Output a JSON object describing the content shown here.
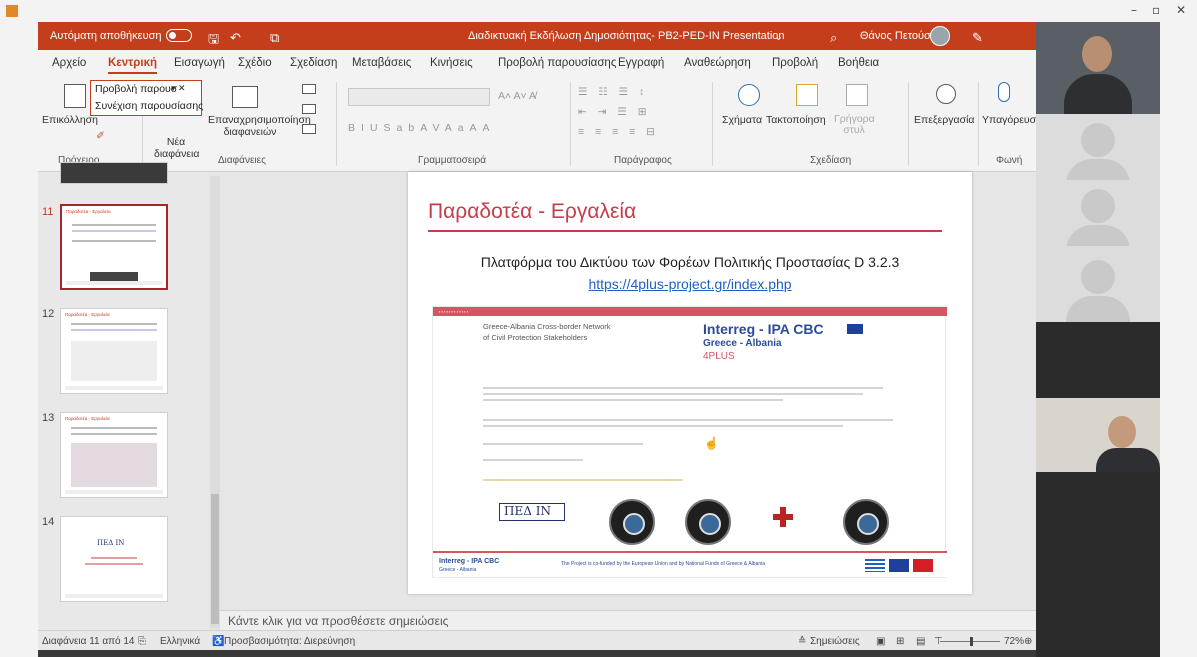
{
  "window": {
    "controls": [
      "–",
      "▫",
      "✕"
    ]
  },
  "titlebar": {
    "autosave": "Αυτόματη αποθήκευση",
    "document": "Διαδικτυακή Εκδήλωση Δημοσιότητας- PB2-PED-IN Presentation",
    "document_caret": "⌄",
    "user": "Θάνος Πετούσης"
  },
  "tabs": [
    "Αρχείο",
    "Κεντρική",
    "Εισαγωγή",
    "Σχέδιο",
    "Σχεδίαση",
    "Μεταβάσεις",
    "Κινήσεις",
    "Προβολή παρουσίασης",
    "Εγγραφή",
    "Αναθεώρηση",
    "Προβολή",
    "Βοήθεια"
  ],
  "active_tab": "Κεντρική",
  "ribbon": {
    "paste": "Επικόλληση",
    "new_slide": "Νέα διαφάνεια",
    "reuse": "Επαναχρησιμοποίηση διαφανειών",
    "shapes": "Σχήματα",
    "arrange": "Τακτοποίηση",
    "quick_styles": "Γρήγορα στυλ",
    "editing": "Επεξεργασία",
    "dictate": "Υπαγόρευση",
    "groups": [
      "Πρόχειρο",
      "Διαφάνειες",
      "Γραμματοσειρά",
      "Παράγραφος",
      "Σχεδίαση",
      "Φωνή"
    ],
    "formatting": [
      "B",
      "I",
      "U",
      "S",
      "ab",
      "AV",
      "Aa",
      "A",
      "A"
    ]
  },
  "dropdown": {
    "items": [
      "Προβολή παρουσ",
      "Συνέχιση παρουσίασης"
    ]
  },
  "thumbnails": {
    "items": [
      {
        "number": "11",
        "title": "Παραδοτέα - Εργαλεία"
      },
      {
        "number": "12",
        "title": "Παραδοτέα - Εργαλεία"
      },
      {
        "number": "13",
        "title": "Παραδοτέα - Εργαλεία"
      },
      {
        "number": "14",
        "title": "ΠΕΔ IN"
      }
    ]
  },
  "slide": {
    "title": "Παραδοτέα - Εργαλεία",
    "subtitle": "Πλατφόρμα του Δικτύου των Φορέων Πολιτικής Προστασίας D 3.2.3",
    "link": "https://4plus-project.gr/index.php",
    "website": {
      "heading_line1": "Greece-Albania Cross-border Network",
      "heading_line2": "of Civil Protection Stakeholders",
      "interreg": "Interreg - IPA CBC",
      "greece_albania": "Greece - Albania",
      "project": "4PLUS",
      "logo_text": "ΠΕΔ IN",
      "footer_logo": "Interreg - IPA CBC",
      "footer_logo_sub": "Greece - Albania",
      "footer_text": "The Project is co-funded by the European Union and by National Funds of Greece & Albania"
    }
  },
  "notes_placeholder": "Κάντε κλικ για να προσθέσετε σημειώσεις",
  "statusbar": {
    "slide_counter": "Διαφάνεια 11 από 14",
    "language": "Ελληνικά",
    "accessibility": "Προσβασιμότητα: Διερεύνηση",
    "notes": "Σημειώσεις",
    "zoom": "72%"
  },
  "colors": {
    "accent": "#c43e1c",
    "slide_title": "#c43e4a",
    "link": "#1f5fc4"
  }
}
